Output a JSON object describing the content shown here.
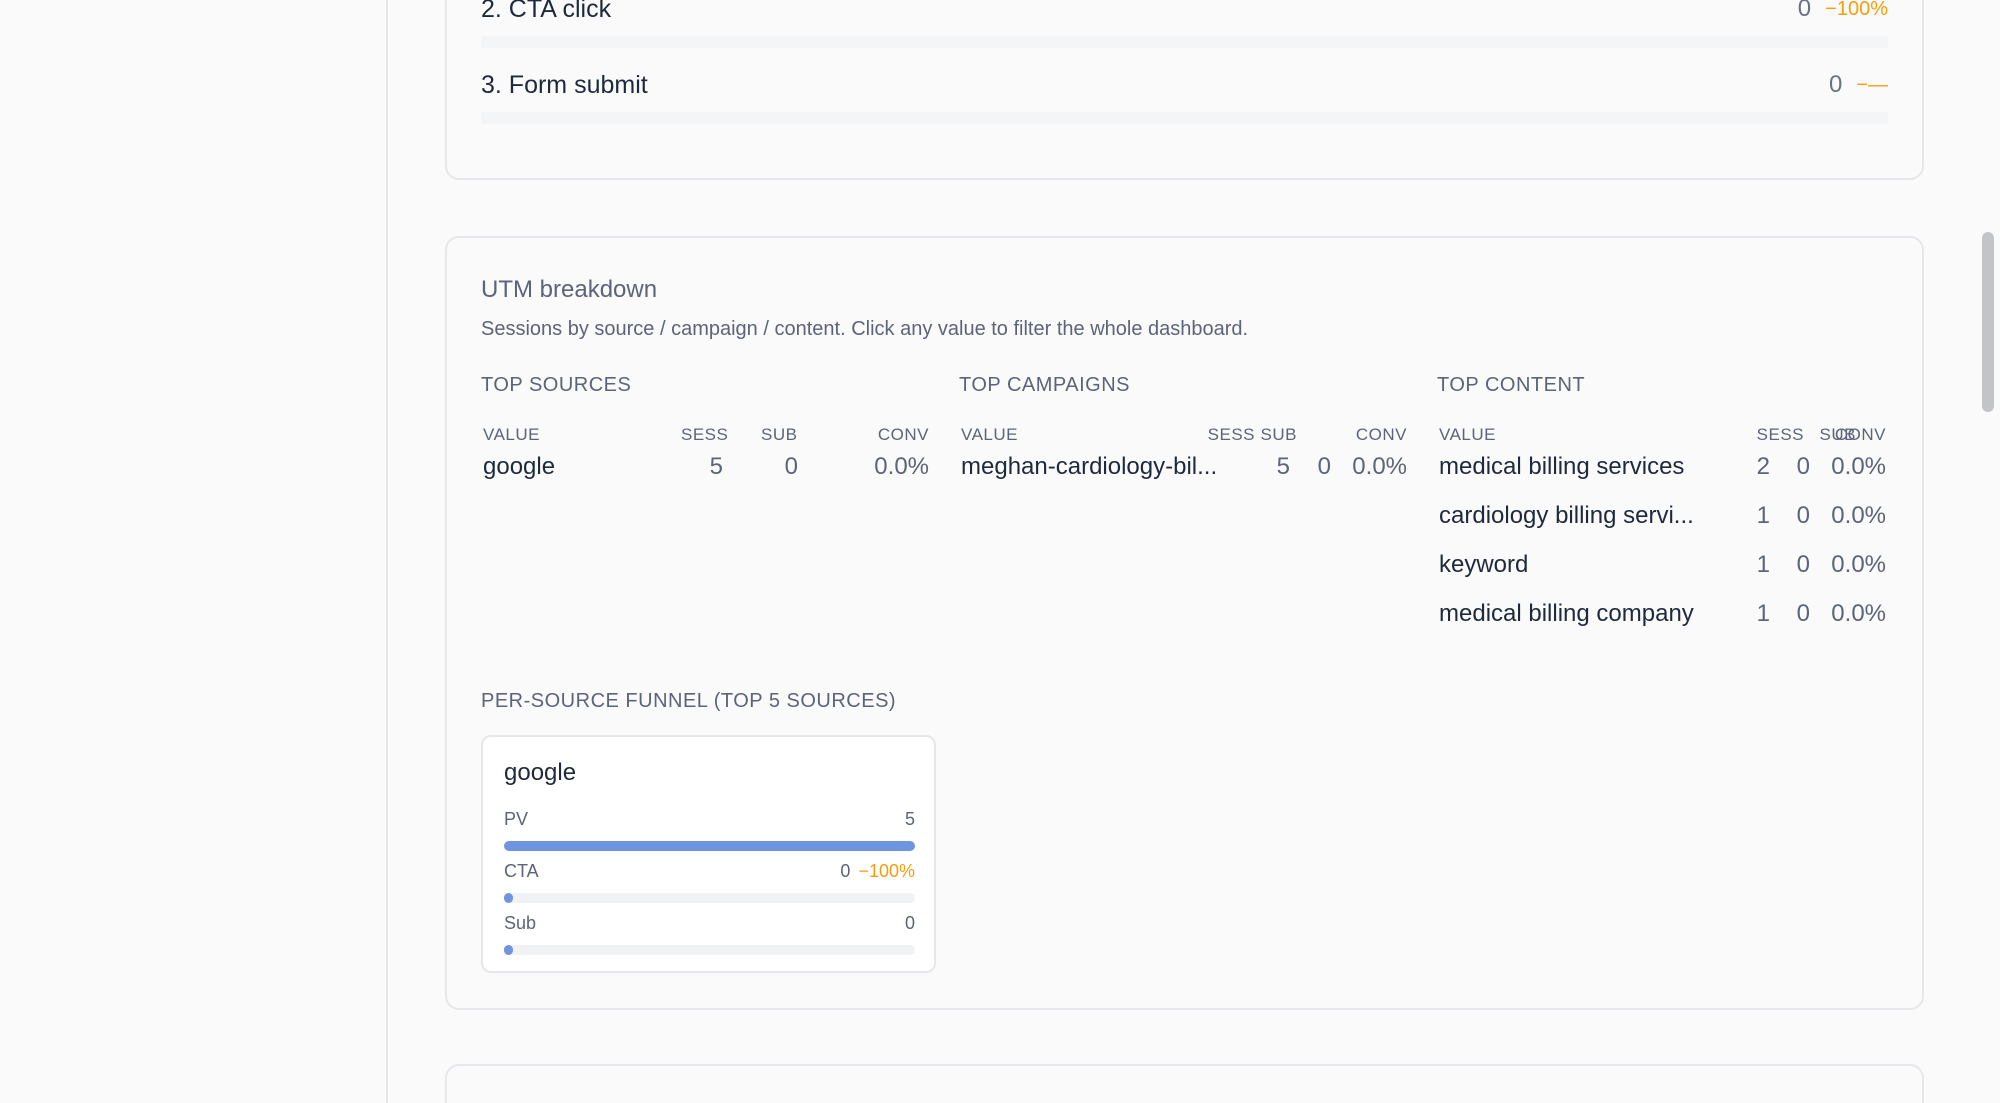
{
  "funnel": {
    "steps": [
      {
        "name": "2. CTA click",
        "count": "0",
        "delta": "−100%"
      },
      {
        "name": "3. Form submit",
        "count": "0",
        "delta": "−—"
      }
    ]
  },
  "utm": {
    "title": "UTM breakdown",
    "subtitle": "Sessions by source / campaign / content. Click any value to filter the whole dashboard.",
    "sources": {
      "title": "TOP SOURCES",
      "headers": {
        "value": "VALUE",
        "sess": "SESS",
        "sub": "SUB",
        "conv": "CONV"
      },
      "rows": [
        {
          "value": "google",
          "sess": "5",
          "sub": "0",
          "conv": "0.0%"
        }
      ]
    },
    "campaigns": {
      "title": "TOP CAMPAIGNS",
      "headers": {
        "value": "VALUE",
        "sess": "SESS",
        "sub": "SUB",
        "conv": "CONV"
      },
      "rows": [
        {
          "value": "meghan-cardiology-bil...",
          "sess": "5",
          "sub": "0",
          "conv": "0.0%"
        }
      ]
    },
    "content": {
      "title": "TOP CONTENT",
      "headers": {
        "value": "VALUE",
        "sess": "SESS",
        "sub": "SUB",
        "conv": "CONV"
      },
      "rows": [
        {
          "value": "medical billing services",
          "sess": "2",
          "sub": "0",
          "conv": "0.0%"
        },
        {
          "value": "cardiology billing servi...",
          "sess": "1",
          "sub": "0",
          "conv": "0.0%"
        },
        {
          "value": "keyword",
          "sess": "1",
          "sub": "0",
          "conv": "0.0%"
        },
        {
          "value": "medical billing company",
          "sess": "1",
          "sub": "0",
          "conv": "0.0%"
        }
      ]
    },
    "per_source": {
      "title": "PER-SOURCE FUNNEL (TOP 5 SOURCES)",
      "cards": [
        {
          "name": "google",
          "bars": [
            {
              "label": "PV",
              "value": "5",
              "delta": "",
              "fill_fraction": 1.0
            },
            {
              "label": "CTA",
              "value": "0",
              "delta": "−100%",
              "fill_fraction": 0.0
            },
            {
              "label": "Sub",
              "value": "0",
              "delta": "",
              "fill_fraction": 0.0
            }
          ]
        }
      ]
    }
  },
  "colors": {
    "accent": "#6f95e0",
    "delta": "#f59e0b",
    "text": "#1e2a3b",
    "muted": "#5b6478"
  }
}
